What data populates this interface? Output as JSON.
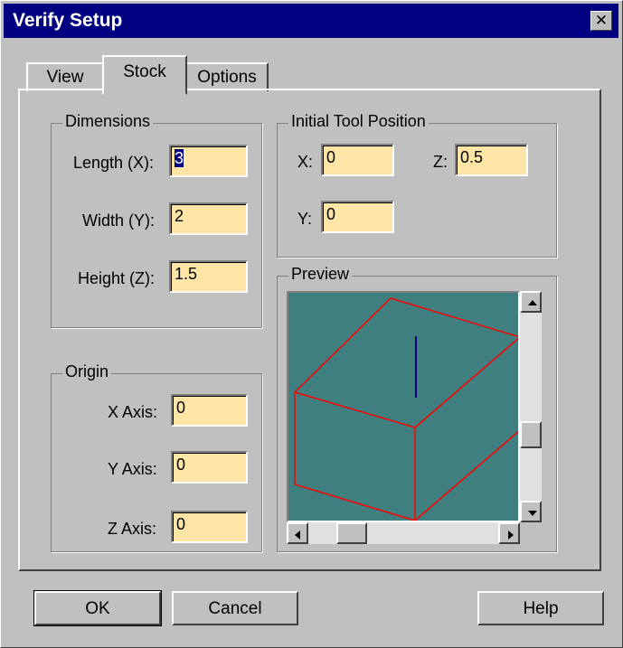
{
  "window": {
    "title": "Verify Setup",
    "close_glyph": "✕"
  },
  "tabs": [
    {
      "label": "View"
    },
    {
      "label": "Stock"
    },
    {
      "label": "Options"
    }
  ],
  "dimensions": {
    "title": "Dimensions",
    "length_label": "Length (X):",
    "length_value": "3",
    "width_label": "Width (Y):",
    "width_value": "2",
    "height_label": "Height (Z):",
    "height_value": "1.5"
  },
  "origin": {
    "title": "Origin",
    "x_label": "X Axis:",
    "x_value": "0",
    "y_label": "Y Axis:",
    "y_value": "0",
    "z_label": "Z Axis:",
    "z_value": "0"
  },
  "tool_position": {
    "title": "Initial Tool Position",
    "x_label": "X:",
    "x_value": "0",
    "y_label": "Y:",
    "y_value": "0",
    "z_label": "Z:",
    "z_value": "0.5"
  },
  "preview": {
    "title": "Preview",
    "bg_color": "#3f7f7f",
    "edge_color": "#ff0000",
    "tool_color": "#000080"
  },
  "buttons": {
    "ok": "OK",
    "cancel": "Cancel",
    "help": "Help"
  },
  "colors": {
    "titlebar": "#000080",
    "field_bg": "#ffe6a6",
    "face": "#c0c0c0"
  }
}
